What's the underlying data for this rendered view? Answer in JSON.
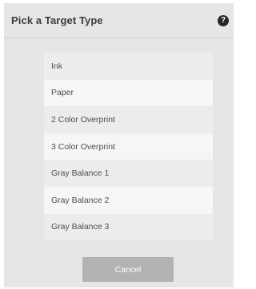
{
  "dialog": {
    "title": "Pick a Target Type",
    "help_icon_glyph": "?",
    "help_icon": "help-circle-icon"
  },
  "target_types": [
    "Ink",
    "Paper",
    "2 Color Overprint",
    "3 Color Overprint",
    "Gray Balance 1",
    "Gray Balance 2",
    "Gray Balance 3"
  ],
  "footer": {
    "cancel_label": "Cancel"
  },
  "colors": {
    "dialog_background": "#e6e6e6",
    "list_row_dark": "#ececec",
    "list_row_light": "#f6f6f6",
    "cancel_button": "#b3b3b3",
    "title_text": "#3b3b3b"
  }
}
